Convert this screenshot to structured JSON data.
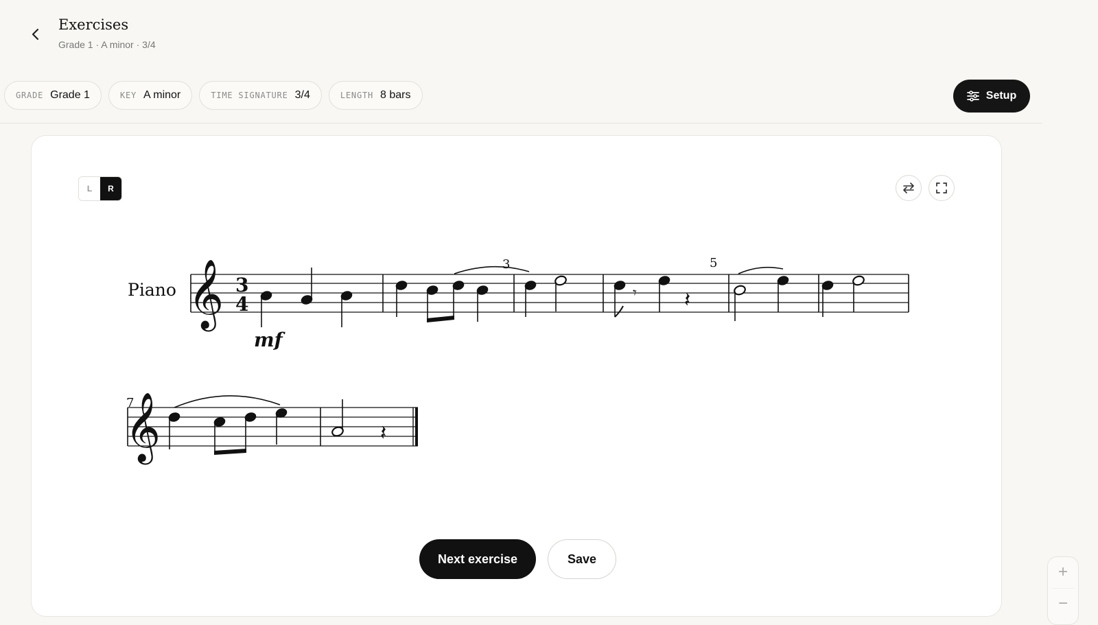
{
  "header": {
    "title": "Exercises",
    "subtitle": "Grade 1 · A minor · 3/4"
  },
  "chips": [
    {
      "key": "GRADE",
      "value": "Grade 1"
    },
    {
      "key": "KEY",
      "value": "A minor"
    },
    {
      "key": "TIME SIGNATURE",
      "value": "3/4"
    },
    {
      "key": "LENGTH",
      "value": "8 bars"
    }
  ],
  "setup_label": "Setup",
  "hand_toggle": {
    "left": "L",
    "right": "R",
    "selected": "R"
  },
  "score": {
    "instrument": "Piano",
    "time_signature_top": "3",
    "time_signature_bottom": "4",
    "dynamic": "mf",
    "triplet_mark": "3",
    "measure_numbers": [
      "5",
      "7"
    ]
  },
  "actions": {
    "next": "Next exercise",
    "save": "Save"
  },
  "zoom": {
    "in": "+",
    "out": "−"
  },
  "colors": {
    "accent": "#151515",
    "background": "#f8f7f3",
    "card": "#ffffff"
  }
}
